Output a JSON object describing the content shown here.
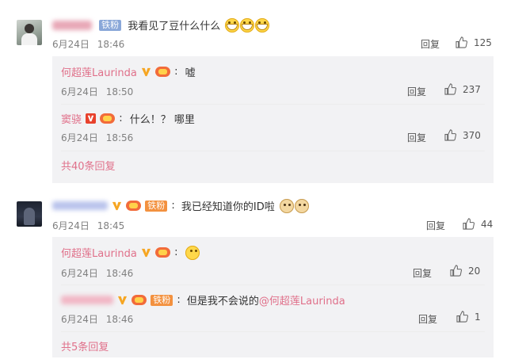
{
  "comments": [
    {
      "badge": "铁粉",
      "text": "我看见了豆什么什么",
      "emojis": [
        "grin-emoji",
        "grin-emoji",
        "grin-emoji"
      ],
      "date": "6月24日",
      "time": "18:46",
      "reply_label": "回复",
      "likes": "125",
      "replies": [
        {
          "name": "何超莲Laurinda",
          "text": "嘘",
          "date": "6月24日",
          "time": "18:50",
          "reply_label": "回复",
          "likes": "237"
        },
        {
          "name": "窦骁",
          "text": "什么！？ 哪里",
          "date": "6月24日",
          "time": "18:56",
          "reply_label": "回复",
          "likes": "370"
        }
      ],
      "more_label": "共40条回复"
    },
    {
      "badge": "铁粉",
      "text": "我已经知道你的ID啦",
      "emojis": [
        "doge-emoji",
        "doge-emoji"
      ],
      "date": "6月24日",
      "time": "18:45",
      "reply_label": "回复",
      "likes": "44",
      "replies": [
        {
          "name": "何超莲Laurinda",
          "text": "",
          "date": "6月24日",
          "time": "18:46",
          "reply_label": "回复",
          "likes": "20"
        },
        {
          "badge": "铁粉",
          "text": "但是我不会说的",
          "mention": "@何超莲Laurinda",
          "date": "6月24日",
          "time": "18:46",
          "reply_label": "回复",
          "likes": "1"
        }
      ],
      "more_label": "共5条回复"
    }
  ],
  "colors": {
    "name_pink": "#e0708a",
    "meta_gray": "#808080",
    "subbox_bg": "#f2f2f4"
  }
}
